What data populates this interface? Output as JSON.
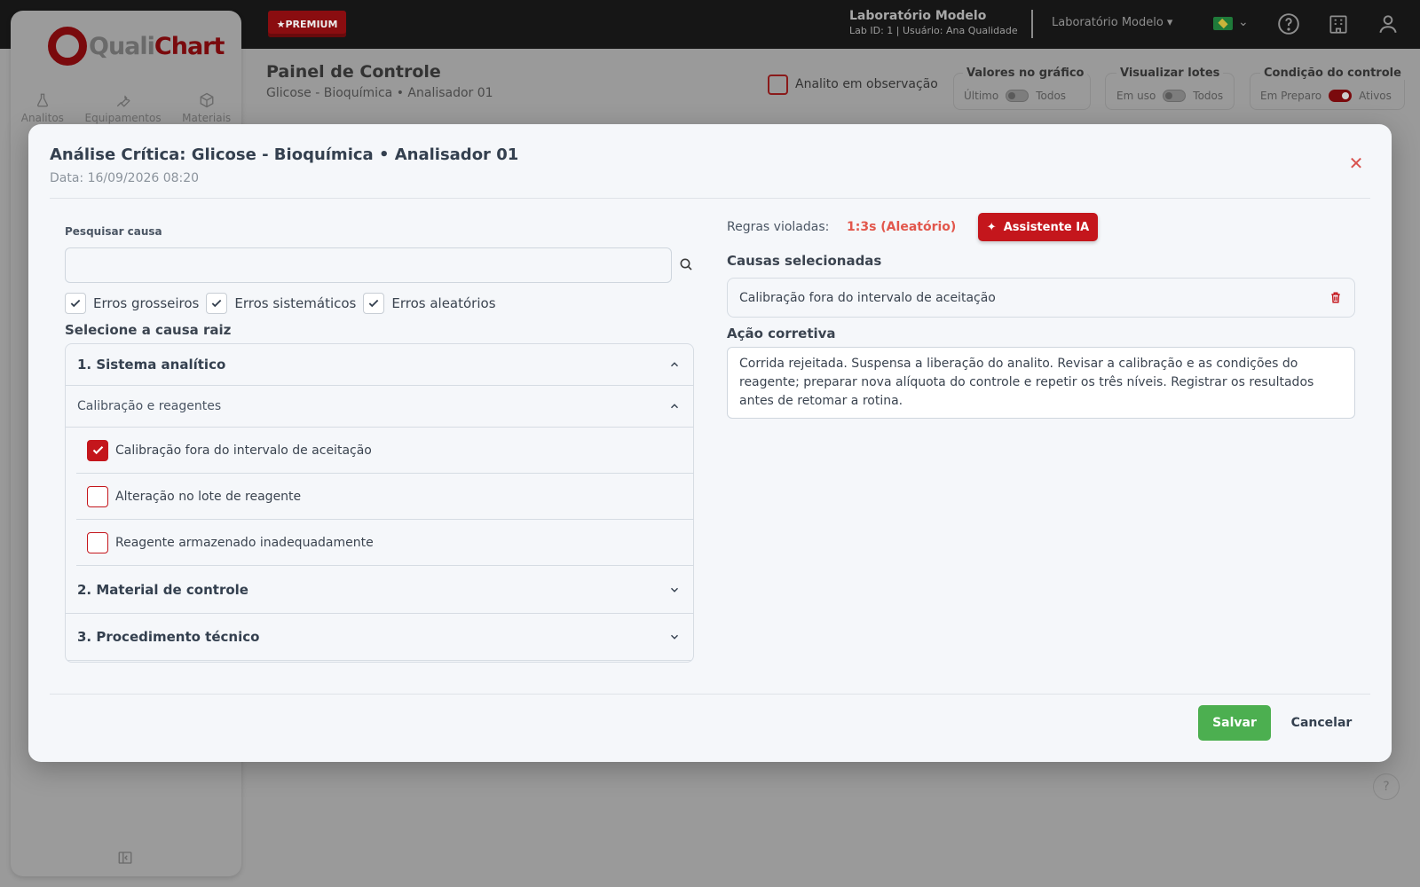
{
  "header": {
    "premium_label": "PREMIUM",
    "lab_name": "Laboratório Modelo",
    "lab_sub": "Lab ID: 1 | Usuário: Ana Qualidade",
    "lab_select": "Laboratório Modelo ▾"
  },
  "sidebar": {
    "logo_text_a": "Quali",
    "logo_text_b": "Chart",
    "nav": [
      {
        "label": "Analitos",
        "icon": "flask-icon"
      },
      {
        "label": "Equipamentos",
        "icon": "wrench-icon"
      },
      {
        "label": "Materiais",
        "icon": "box-icon"
      }
    ]
  },
  "background": {
    "title": "Painel de Controle",
    "subtitle": "Glicose - Bioquímica • Analisador 01",
    "observation_label": "Analito em observação",
    "toggles": [
      {
        "title": "Valores no gráfico",
        "left": "Último",
        "right": "Todos",
        "on": false
      },
      {
        "title": "Visualizar lotes",
        "left": "Em uso",
        "right": "Todos",
        "on": false
      },
      {
        "title": "Condição do controle",
        "left": "Em Preparo",
        "right": "Ativos",
        "on": true
      }
    ]
  },
  "modal": {
    "title": "Análise Crítica: Glicose - Bioquímica • Analisador 01",
    "date": "Data: 16/09/2026 08:20",
    "search_label": "Pesquisar causa",
    "search_value": "",
    "filters": [
      {
        "label": "Erros grosseiros",
        "checked": true
      },
      {
        "label": "Erros sistemáticos",
        "checked": true
      },
      {
        "label": "Erros aleatórios",
        "checked": true
      }
    ],
    "root_label": "Selecione a causa raiz",
    "tree": {
      "section1": "1. Sistema analítico",
      "subsection": "Calibração e reagentes",
      "items": [
        {
          "label": "Calibração fora do intervalo de aceitação",
          "checked": true
        },
        {
          "label": "Alteração no lote de reagente",
          "checked": false
        },
        {
          "label": "Reagente armazenado inadequadamente",
          "checked": false
        }
      ],
      "section2": "2. Material de controle",
      "section3": "3. Procedimento técnico"
    },
    "rules_label": "Regras violadas:",
    "rules_value": "1:3s (Aleatório)",
    "ai_button": "Assistente IA",
    "causes_label": "Causas selecionadas",
    "selected_cause": "Calibração fora do intervalo de aceitação",
    "action_label": "Ação corretiva",
    "action_text": "Corrida rejeitada. Suspensa a liberação do analito. Revisar a calibração e as condições do reagente; preparar nova alíquota do controle e repetir os três níveis. Registrar os resultados antes de retomar a rotina.",
    "save_label": "Salvar",
    "cancel_label": "Cancelar"
  },
  "colors": {
    "accent": "#c4161c",
    "save": "#4caf50",
    "rule": "#e2574c"
  }
}
